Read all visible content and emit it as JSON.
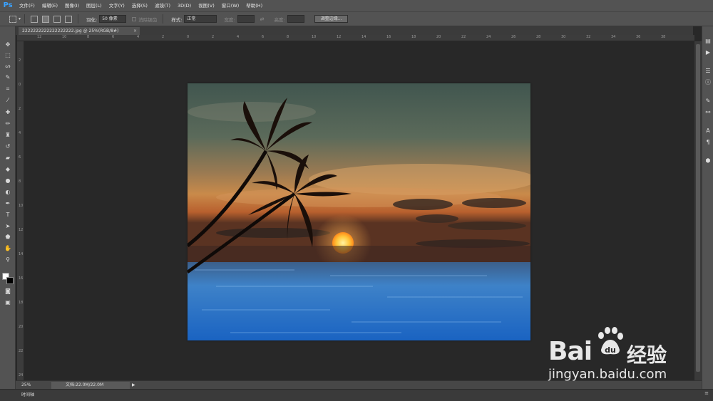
{
  "app": {
    "logo": "Ps"
  },
  "menu": [
    "文件(F)",
    "编辑(E)",
    "图像(I)",
    "图层(L)",
    "文字(Y)",
    "选择(S)",
    "滤镜(T)",
    "3D(D)",
    "视图(V)",
    "窗口(W)",
    "帮助(H)"
  ],
  "options": {
    "feather_label": "羽化:",
    "feather_value": "50 像素",
    "antialias_label": "消除锯齿",
    "style_label": "样式:",
    "style_value": "正常",
    "width_label": "宽度:",
    "height_label": "高度:",
    "refine_edge_button": "调整边缘..."
  },
  "document": {
    "tab_title": "2222222222222222222.jpg @ 25%(RGB/8#)",
    "close": "×"
  },
  "ruler": {
    "top_ticks": [
      "12",
      "10",
      "8",
      "6",
      "4",
      "2",
      "0",
      "2",
      "4",
      "6",
      "8",
      "10",
      "12",
      "14",
      "16",
      "18",
      "20",
      "22",
      "24",
      "26",
      "28",
      "30",
      "32",
      "34",
      "36",
      "38"
    ],
    "left_ticks": [
      "2",
      "0",
      "2",
      "4",
      "6",
      "8",
      "10",
      "12",
      "14",
      "16",
      "18",
      "20",
      "22",
      "24"
    ]
  },
  "status": {
    "zoom": "25%",
    "doc_info": "文档:22.0M/22.0M",
    "arrow": "▶"
  },
  "timeline": {
    "label": "时间轴",
    "menu": "≡"
  },
  "watermark": {
    "brand": "Bai",
    "brand_du": "du",
    "chinese": "经验",
    "url": "jingyan.baidu.com"
  },
  "icons": {
    "tools": [
      "move-icon",
      "marquee-icon",
      "lasso-icon",
      "quick-select-icon",
      "crop-icon",
      "eyedropper-icon",
      "healing-brush-icon",
      "brush-icon",
      "clone-stamp-icon",
      "history-brush-icon",
      "eraser-icon",
      "paint-bucket-icon",
      "blur-icon",
      "dodge-icon",
      "pen-icon",
      "type-icon",
      "path-select-icon",
      "shape-icon",
      "hand-icon",
      "zoom-icon",
      "quick-mask-icon",
      "screen-mode-icon"
    ]
  }
}
